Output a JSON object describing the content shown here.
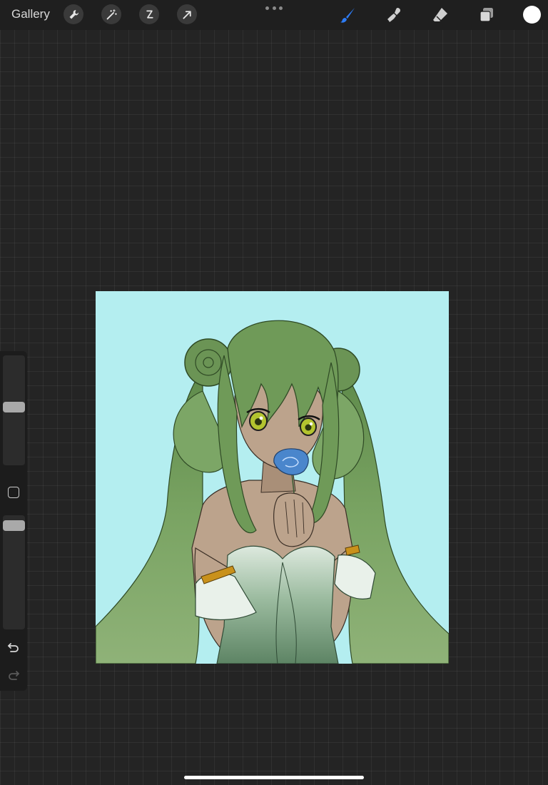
{
  "topbar": {
    "gallery_label": "Gallery",
    "left_tools": [
      "wrench-icon",
      "magic-wand-icon",
      "selection-icon",
      "transform-arrow-icon"
    ],
    "right_tools": [
      "brush-icon",
      "smudge-icon",
      "eraser-icon",
      "layers-icon"
    ],
    "active_tool": "brush-icon"
  },
  "colors": {
    "accent": "#2d7cf6",
    "current_color": "#ffffff",
    "canvas_background": "#b4eef0",
    "hair": "#6f9a58",
    "skin": "#bca38c",
    "dress": "#a9c6ad",
    "rose": "#4a86cc",
    "gold": "#c9911b"
  },
  "sidebar": {
    "brush_size_level": 0.53,
    "opacity_level": 0.05,
    "undo_icon": "undo-icon",
    "redo_icon": "redo-icon"
  }
}
